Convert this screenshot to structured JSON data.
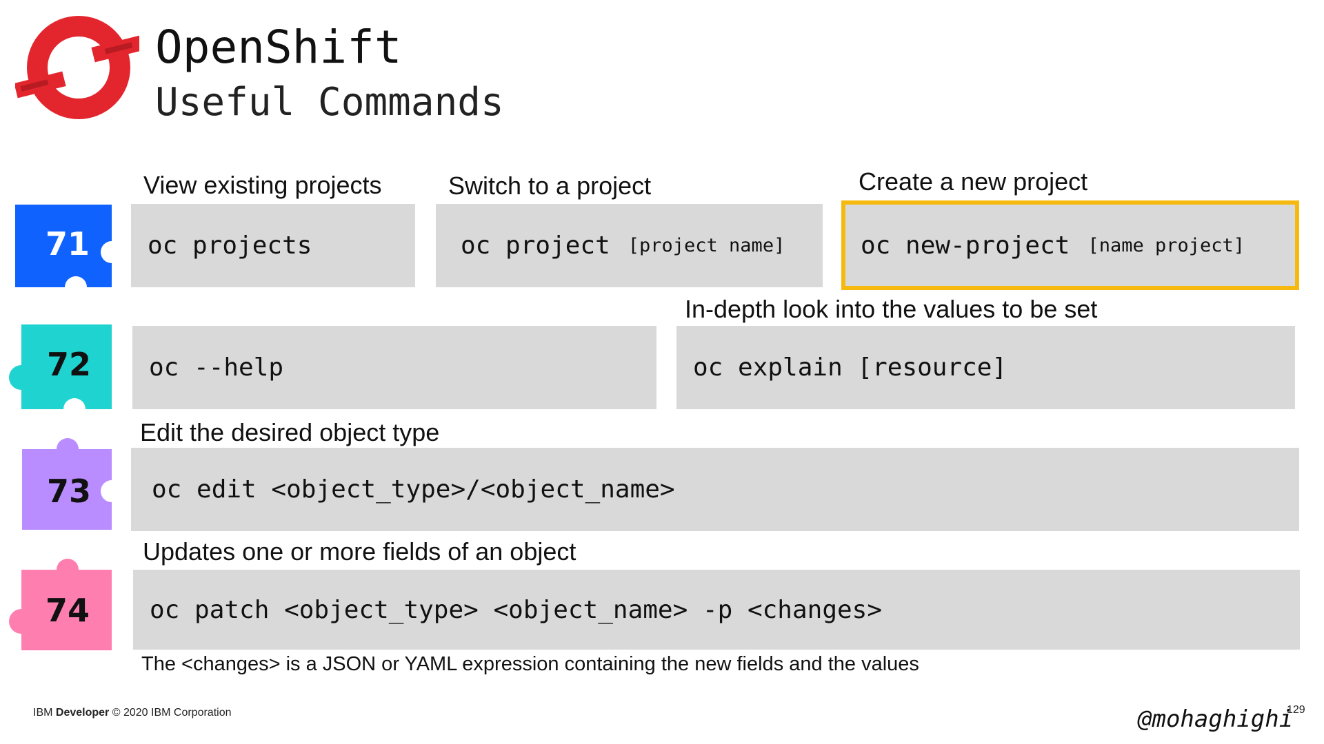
{
  "header": {
    "title": "OpenShift",
    "subtitle": "Useful Commands"
  },
  "colors": {
    "logo_red": "#e3262e",
    "piece_71": "#0f62fe",
    "piece_72": "#1fd3d0",
    "piece_73": "#b98cff",
    "piece_74": "#ff7eb0",
    "box_grey": "#d9d9d9",
    "highlight": "#f5b90f"
  },
  "commands": {
    "c71": {
      "number": "71",
      "view": {
        "label": "View existing projects",
        "cmd": "oc projects"
      },
      "switch": {
        "label": "Switch to a project",
        "cmd": "oc project",
        "arg": "[project name]"
      },
      "create": {
        "label": "Create a new project",
        "cmd": "oc new-project",
        "arg": "[name project]"
      }
    },
    "c72": {
      "number": "72",
      "help": {
        "cmd": "oc --help"
      },
      "explain": {
        "label": "In-depth look into the values to be set",
        "cmd": "oc explain [resource]"
      }
    },
    "c73": {
      "number": "73",
      "label": "Edit the desired object type",
      "cmd": "oc edit <object_type>/<object_name>"
    },
    "c74": {
      "number": "74",
      "label": "Updates one or more fields of an object",
      "cmd": "oc patch <object_type> <object_name> -p <changes>",
      "note": "The <changes> is a JSON or YAML expression containing the new fields and the values"
    }
  },
  "footer": {
    "brand_prefix": "IBM",
    "brand_bold": "Developer",
    "copyright": "© 2020 IBM Corporation",
    "handle": "@mohaghighi",
    "page_number": "129"
  }
}
